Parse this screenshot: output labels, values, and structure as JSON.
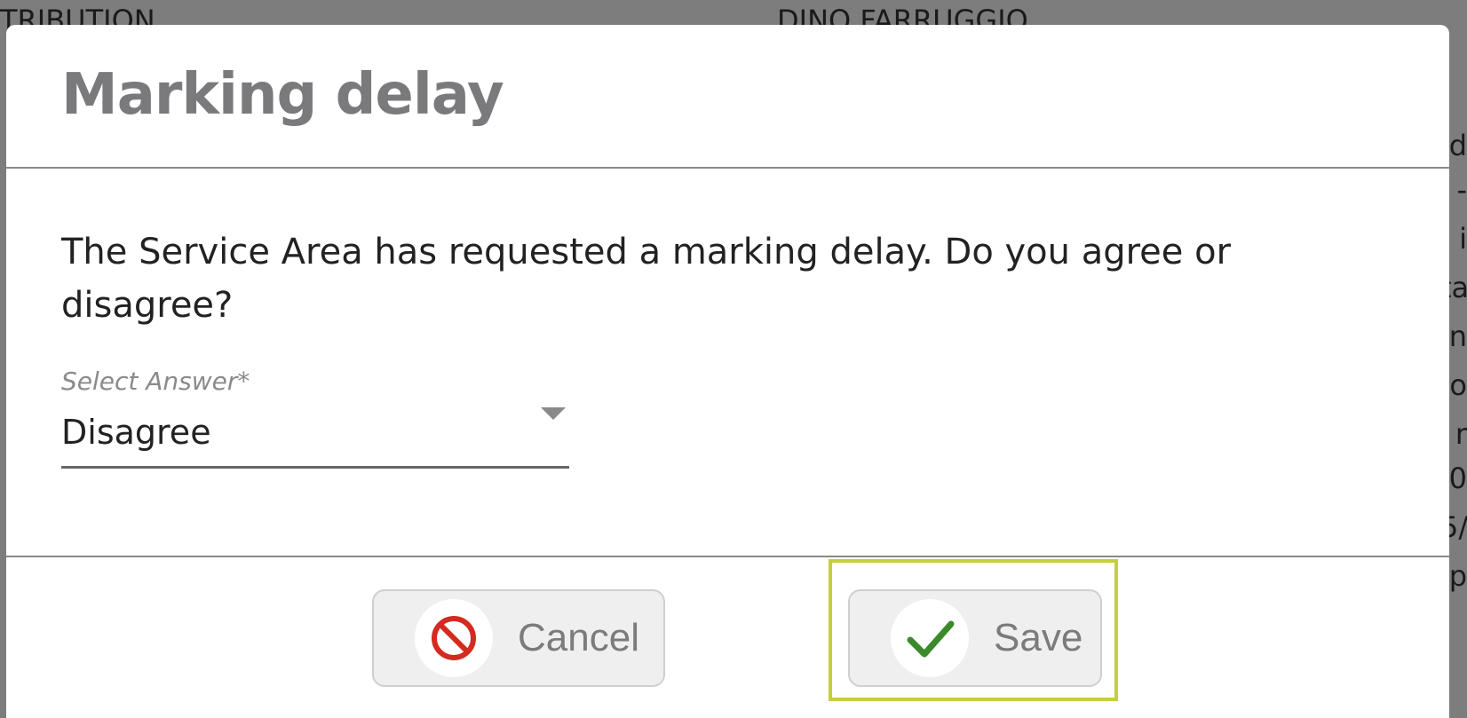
{
  "background": {
    "fragment_left": "TRIBUTION",
    "fragment_right": "DINO FARRUGGIO",
    "edge_glyphs": [
      "d",
      "-",
      "i",
      "ta",
      "n",
      "o",
      "r",
      "0",
      "5/",
      "p"
    ]
  },
  "dialog": {
    "title": "Marking delay",
    "question": "The Service Area has requested a marking delay. Do you agree or disagree?",
    "select": {
      "label": "Select Answer*",
      "value": "Disagree"
    },
    "buttons": {
      "cancel": {
        "label": "Cancel",
        "icon": "prohibited-icon"
      },
      "save": {
        "label": "Save",
        "icon": "checkmark-icon"
      }
    }
  },
  "colors": {
    "title": "#7a7a7d",
    "cancel_icon": "#d42a20",
    "save_icon": "#3a8a2a",
    "focus_ring": "#c4cf3a"
  }
}
